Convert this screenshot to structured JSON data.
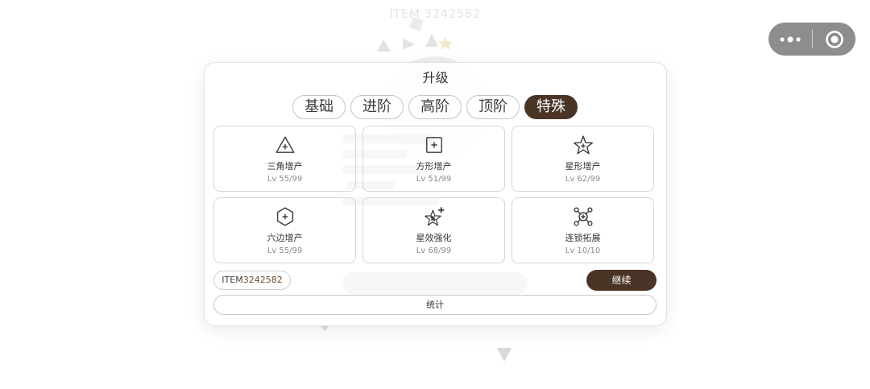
{
  "background": {
    "title": "ITEM 3242582"
  },
  "capsule": {
    "more_icon": "more-dots-icon",
    "close_icon": "target-circle-icon"
  },
  "colors": {
    "accent": "#4a3426",
    "card_border": "#d6d6d6",
    "text": "#333333",
    "muted": "#8a8a8a",
    "capsule": "#8d8d8d"
  },
  "dialog": {
    "title": "升级",
    "tabs": [
      {
        "label": "基础",
        "selected": false
      },
      {
        "label": "进阶",
        "selected": false
      },
      {
        "label": "高阶",
        "selected": false
      },
      {
        "label": "顶阶",
        "selected": false
      },
      {
        "label": "特殊",
        "selected": true
      }
    ],
    "cards": [
      {
        "icon": "triangle-plus-icon",
        "name": "三角增产",
        "level": "Lv 55/99"
      },
      {
        "icon": "square-plus-icon",
        "name": "方形增产",
        "level": "Lv 51/99"
      },
      {
        "icon": "star-plus-icon",
        "name": "星形增产",
        "level": "Lv 62/99"
      },
      {
        "icon": "hexagon-plus-icon",
        "name": "六边增产",
        "level": "Lv 55/99"
      },
      {
        "icon": "star-percent-boost-icon",
        "name": "星效强化",
        "level": "Lv 68/99"
      },
      {
        "icon": "chain-network-icon",
        "name": "连锁拓展",
        "level": "Lv 10/10"
      }
    ],
    "item_tag": {
      "prefix": "ITEM",
      "id": "3242582"
    },
    "continue_label": "继续",
    "stats_label": "统计"
  }
}
